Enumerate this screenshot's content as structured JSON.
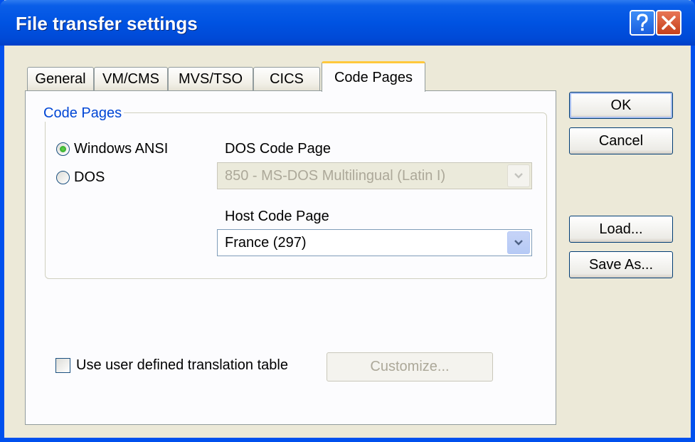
{
  "window": {
    "title": "File transfer settings",
    "help_icon": "question-mark-icon",
    "close_icon": "close-x-icon"
  },
  "tabs": [
    {
      "label": "General",
      "active": false
    },
    {
      "label": "VM/CMS",
      "active": false
    },
    {
      "label": "MVS/TSO",
      "active": false
    },
    {
      "label": "CICS",
      "active": false
    },
    {
      "label": "Code Pages",
      "active": true
    }
  ],
  "code_pages": {
    "group_title": "Code Pages",
    "radio_windows_ansi": "Windows ANSI",
    "radio_dos": "DOS",
    "selected_radio": "Windows ANSI",
    "dos_code_page_label": "DOS Code Page",
    "dos_code_page_value": "850 - MS-DOS Multilingual (Latin I)",
    "host_code_page_label": "Host Code Page",
    "host_code_page_value": "France (297)"
  },
  "translation": {
    "checkbox_label": "Use user defined translation table",
    "checked": false,
    "customize_label": "Customize..."
  },
  "buttons": {
    "ok": "OK",
    "cancel": "Cancel",
    "load": "Load...",
    "save_as": "Save As..."
  },
  "colors": {
    "titlebar": "#0053e2",
    "accent_tab": "#ffc83c",
    "group_title": "#0046d5",
    "dialog_bg": "#ece9d8"
  }
}
